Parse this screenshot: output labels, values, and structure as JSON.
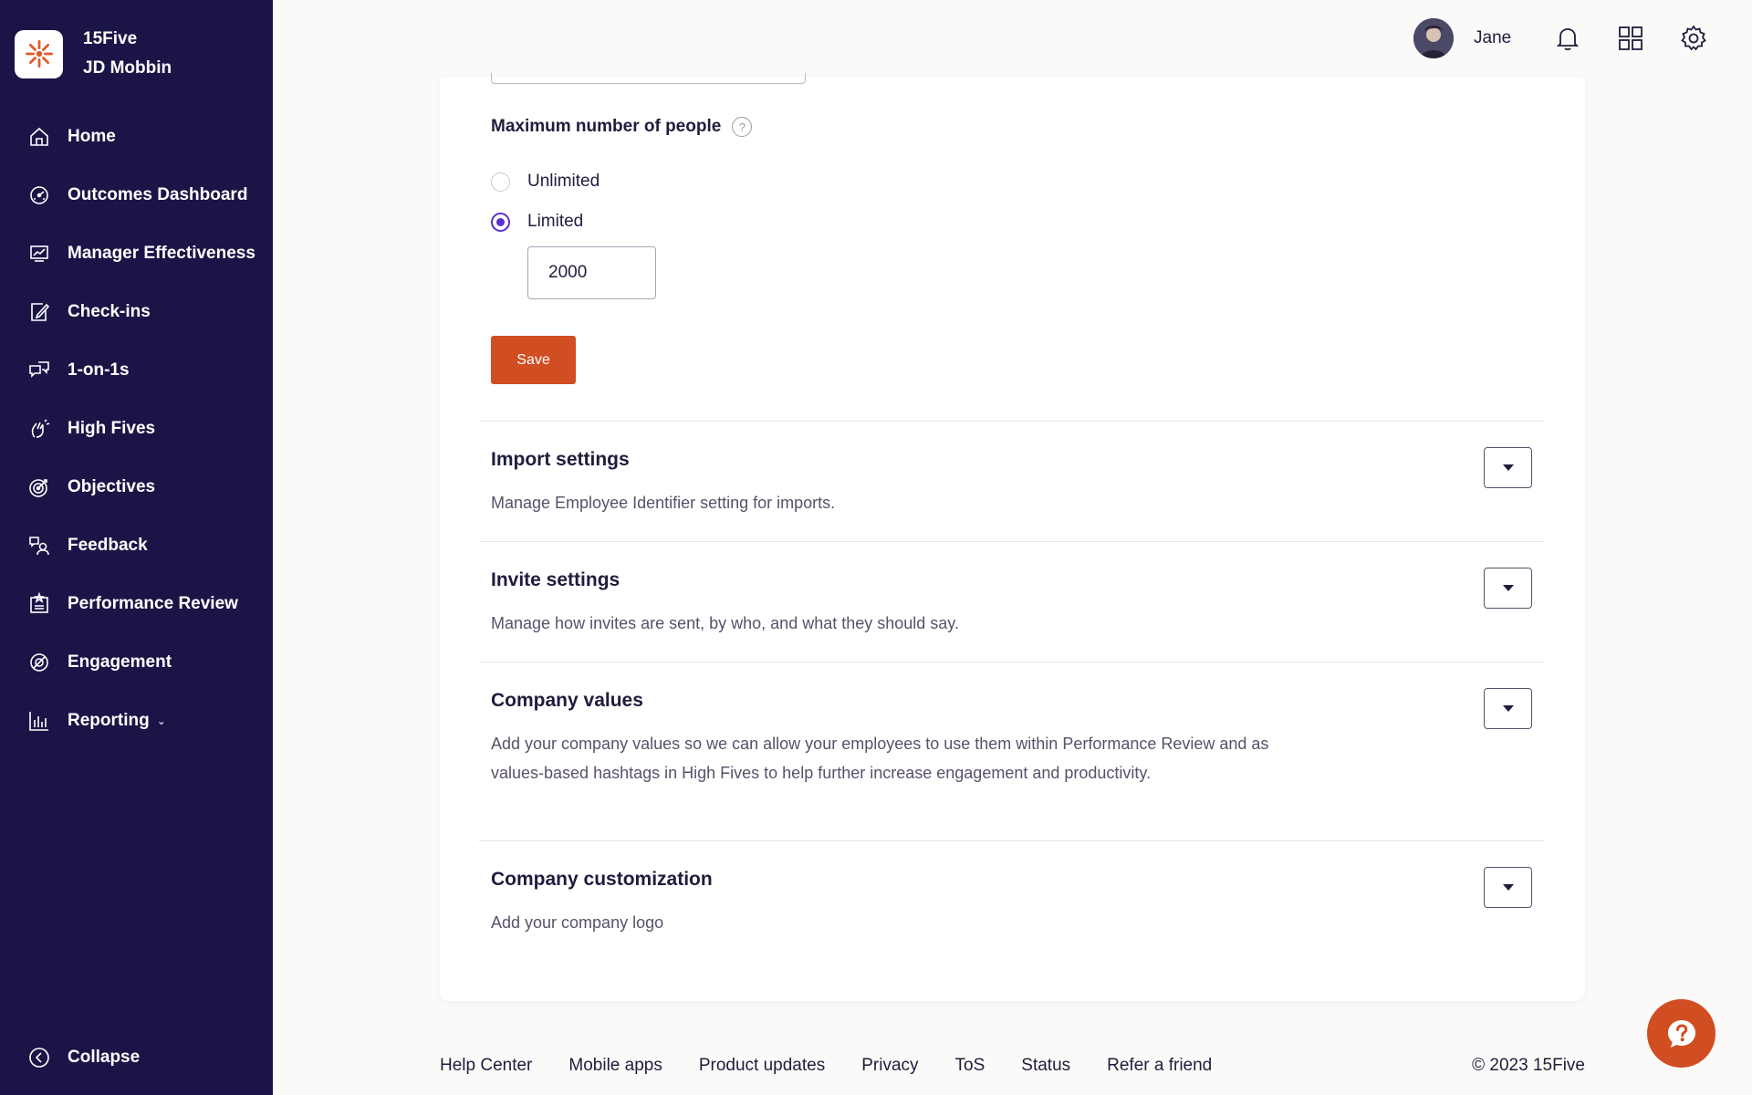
{
  "brand": {
    "company": "15Five",
    "account": "JD Mobbin"
  },
  "sidebar": {
    "items": [
      {
        "label": "Home",
        "icon": "home-icon"
      },
      {
        "label": "Outcomes Dashboard",
        "icon": "dashboard-icon"
      },
      {
        "label": "Manager Effectiveness",
        "icon": "manager-effectiveness-icon"
      },
      {
        "label": "Check-ins",
        "icon": "check-in-icon"
      },
      {
        "label": "1-on-1s",
        "icon": "one-on-one-icon"
      },
      {
        "label": "High Fives",
        "icon": "high-five-icon"
      },
      {
        "label": "Objectives",
        "icon": "target-icon"
      },
      {
        "label": "Feedback",
        "icon": "feedback-icon"
      },
      {
        "label": "Performance Review",
        "icon": "performance-review-icon"
      },
      {
        "label": "Engagement",
        "icon": "engagement-icon"
      },
      {
        "label": "Reporting",
        "icon": "bar-chart-icon"
      }
    ],
    "collapse_label": "Collapse"
  },
  "topbar": {
    "user_name": "Jane"
  },
  "form": {
    "max_people_label": "Maximum number of people",
    "help_glyph": "?",
    "options": {
      "unlimited": "Unlimited",
      "limited": "Limited"
    },
    "selected": "limited",
    "limit_value": "2000",
    "save_label": "Save"
  },
  "sections": [
    {
      "title": "Import settings",
      "description": "Manage Employee Identifier setting for imports."
    },
    {
      "title": "Invite settings",
      "description": "Manage how invites are sent, by who, and what they should say."
    },
    {
      "title": "Company values",
      "description": "Add your company values so we can allow your employees to use them within Performance Review and as values-based hashtags in High Fives to help further increase engagement and productivity."
    },
    {
      "title": "Company customization",
      "description": "Add your company logo"
    }
  ],
  "footer": {
    "links": [
      "Help Center",
      "Mobile apps",
      "Product updates",
      "Privacy",
      "ToS",
      "Status",
      "Refer a friend"
    ],
    "copyright": "© 2023 15Five"
  },
  "colors": {
    "sidebar_bg": "#1a1546",
    "accent": "#d14d22",
    "radio": "#5a2fd0"
  }
}
